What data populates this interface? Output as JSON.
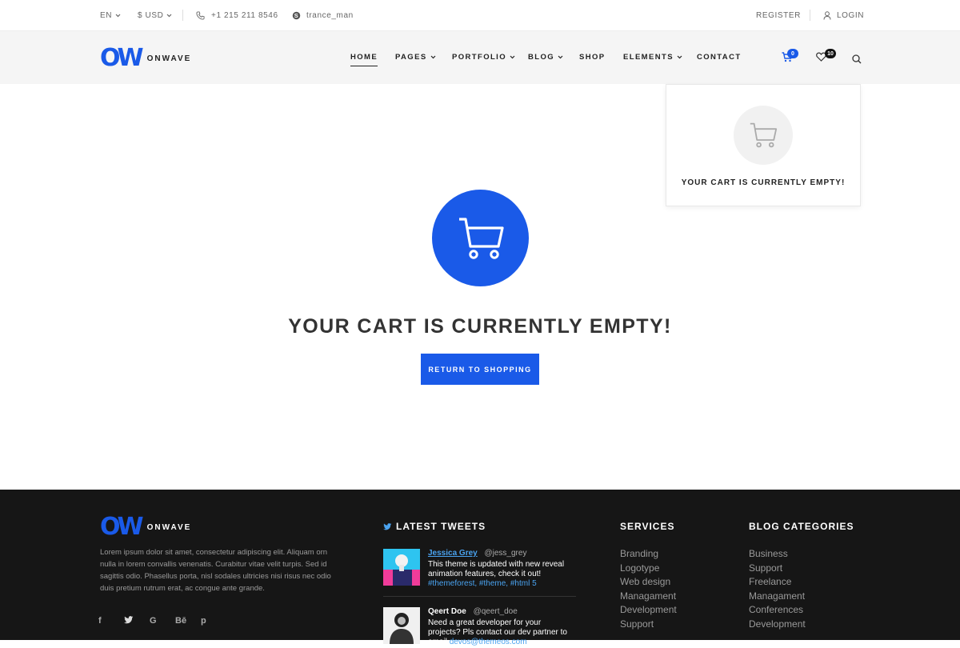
{
  "topbar": {
    "language": "EN",
    "currency": "$ USD",
    "phone": "+1 215 211 8546",
    "skype": "trance_man",
    "register": "REGISTER",
    "login": "LOGIN"
  },
  "header": {
    "logo_mark": "OW",
    "logo_word": "ONWAVE",
    "nav": [
      {
        "label": "HOME"
      },
      {
        "label": "PAGES"
      },
      {
        "label": "PORTFOLIO"
      },
      {
        "label": "BLOG"
      },
      {
        "label": "SHOP"
      },
      {
        "label": "ELEMENTS"
      },
      {
        "label": "CONTACT"
      }
    ],
    "cart_count": "0",
    "wishlist_count": "10"
  },
  "main": {
    "empty_title": "YOUR CART IS CURRENTLY EMPTY!",
    "return_button": "RETURN TO SHOPPING"
  },
  "mini_cart": {
    "text": "YOUR CART IS CURRENTLY EMPTY!"
  },
  "footer": {
    "logo_mark": "OW",
    "logo_word": "ONWAVE",
    "about": "Lorem ipsum dolor sit amet, consectetur adipiscing elit. Aliquam orn nulla in lorem convallis venenatis. Curabitur vitae velit turpis. Sed id sagittis odio. Phasellus porta, nisl sodales ultricies nisi risus nec odio duis pretium rutrum erat, ac congue ante  grande.",
    "socials": [
      "f",
      "t",
      "G",
      "Bē",
      "p"
    ],
    "tweets_heading": "LATEST TWEETS",
    "tweets": [
      {
        "name": "Jessica Grey",
        "handle": "@jess_grey",
        "text": "This theme is updated with new reveal animation features, check it out! ",
        "tags": "#themeforest, #theme, #html 5"
      },
      {
        "name": "Qeert Doe",
        "handle": "@qeert_doe",
        "text": "Need a great developer for your projects? Pls contact our dev partner to email ",
        "tags": "devos@themeos.com"
      }
    ],
    "services_heading": "SERVICES",
    "services": [
      "Branding",
      "Logotype",
      "Web design",
      "Managament",
      "Development",
      "Support"
    ],
    "blog_heading": "BLOG CATEGORIES",
    "blog_categories": [
      "Business",
      "Support",
      "Freelance",
      "Managament",
      "Conferences",
      "Development"
    ]
  },
  "colors": {
    "accent": "#1a5ae8",
    "footer_bg": "#161616",
    "header_bg": "#f5f5f5",
    "link": "#4aa3f0"
  }
}
